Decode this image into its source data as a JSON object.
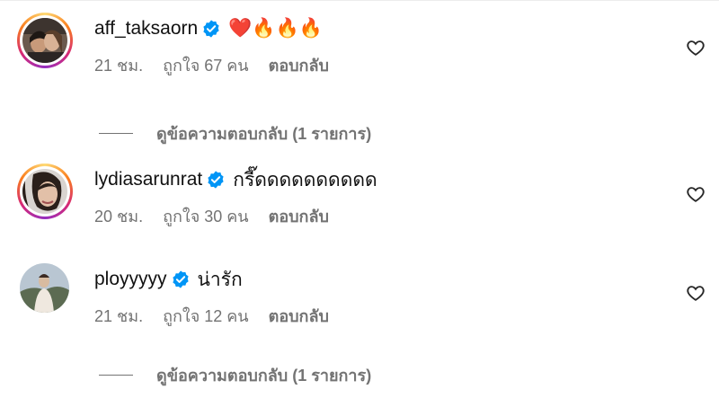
{
  "comments": [
    {
      "username": "aff_taksaorn",
      "text": "❤️🔥🔥🔥",
      "time": "21 ชม.",
      "likes": "ถูกใจ 67 คน",
      "reply": "ตอบกลับ",
      "view_replies": "ดูข้อความตอบกลับ (1 รายการ)"
    },
    {
      "username": "lydiasarunrat",
      "text": "กรี๊ดดดดดดดดดด",
      "time": "20 ชม.",
      "likes": "ถูกใจ 30 คน",
      "reply": "ตอบกลับ"
    },
    {
      "username": "ployyyyy",
      "text": "น่ารัก",
      "time": "21 ชม.",
      "likes": "ถูกใจ 12 คน",
      "reply": "ตอบกลับ",
      "view_replies": "ดูข้อความตอบกลับ (1 รายการ)"
    }
  ],
  "colors": {
    "verified": "#0095f6",
    "meta": "#737373",
    "story_ring": "#d62976"
  },
  "icons": {
    "verified": "verified-badge-icon",
    "like": "heart-outline-icon"
  }
}
